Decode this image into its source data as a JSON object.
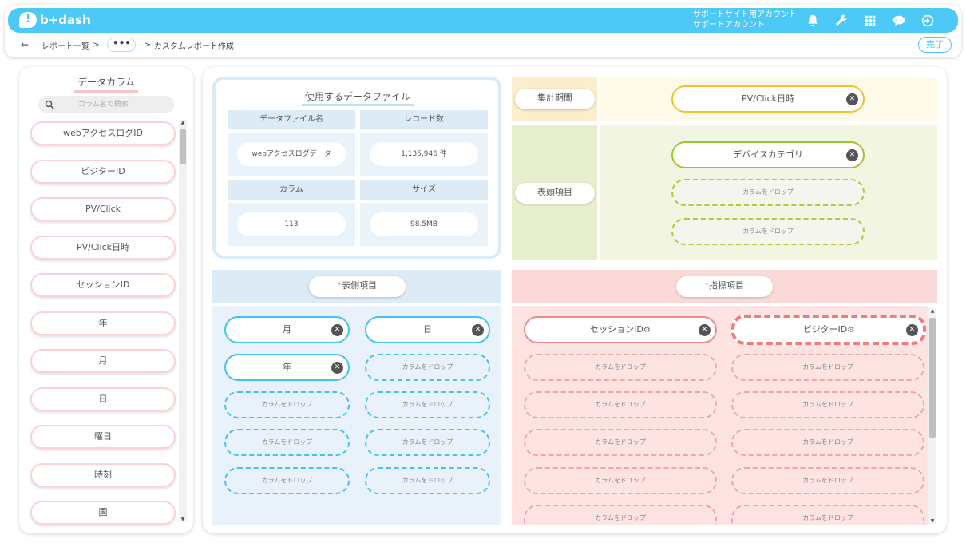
{
  "header": {
    "logo": "b+dash",
    "account_line1": "サポートサイト用アカウント",
    "account_line2": "サポートアカウント",
    "icons": [
      "bell-icon",
      "wrench-icon",
      "grid-icon",
      "chat-icon",
      "logout-icon"
    ],
    "done_label": "完了"
  },
  "breadcrumb": {
    "back": "←",
    "item1": "レポート一覧",
    "sep": ">",
    "ellipsis": "•••",
    "current": "カスタムレポート作成"
  },
  "columns": {
    "title": "データカラム",
    "search_placeholder": "カラム名で検索",
    "items": [
      "webアクセスログID",
      "ビジターID",
      "PV/Click",
      "PV/Click日時",
      "セッションID",
      "年",
      "月",
      "日",
      "曜日",
      "時刻",
      "国"
    ]
  },
  "file": {
    "title": "使用するデータファイル",
    "name_label": "データファイル名",
    "name_value": "webアクセスログデータ",
    "records_label": "レコード数",
    "records_value": "1,135,946 件",
    "columns_label": "カラム",
    "columns_value": "113",
    "size_label": "サイズ",
    "size_value": "98.5MB"
  },
  "period": {
    "label": "集計期間",
    "chip": "PV/Click日時"
  },
  "head_items": {
    "label": "表頭項目",
    "chip": "デバイスカテゴリ",
    "drop1": "カラムをドロップ",
    "drop2": "カラムをドロップ"
  },
  "row_items": {
    "star": "*",
    "label": "表側項目",
    "chips": [
      "月",
      "日",
      "年"
    ],
    "drops": [
      "カラムをドロップ",
      "カラムをドロップ",
      "カラムをドロップ",
      "カラムをドロップ",
      "カラムをドロップ",
      "カラムをドロップ",
      "カラムをドロップ"
    ]
  },
  "metrics": {
    "star": "*",
    "label": "指標項目",
    "chips": [
      "セッションID",
      "ビジターID"
    ],
    "drops": [
      "カラムをドロップ",
      "カラムをドロップ",
      "カラムをドロップ",
      "カラムをドロップ",
      "カラムをドロップ",
      "カラムをドロップ",
      "カラムをドロップ",
      "カラムをドロップ",
      "カラムをドロップ",
      "カラムをドロップ"
    ]
  },
  "colors": {
    "topbar": "#4cc9f6",
    "blue_section": "#e3eff9",
    "pink_section": "#fde0df",
    "yellow_section": "#fdfaea",
    "green_section": "#f1f5e1"
  }
}
